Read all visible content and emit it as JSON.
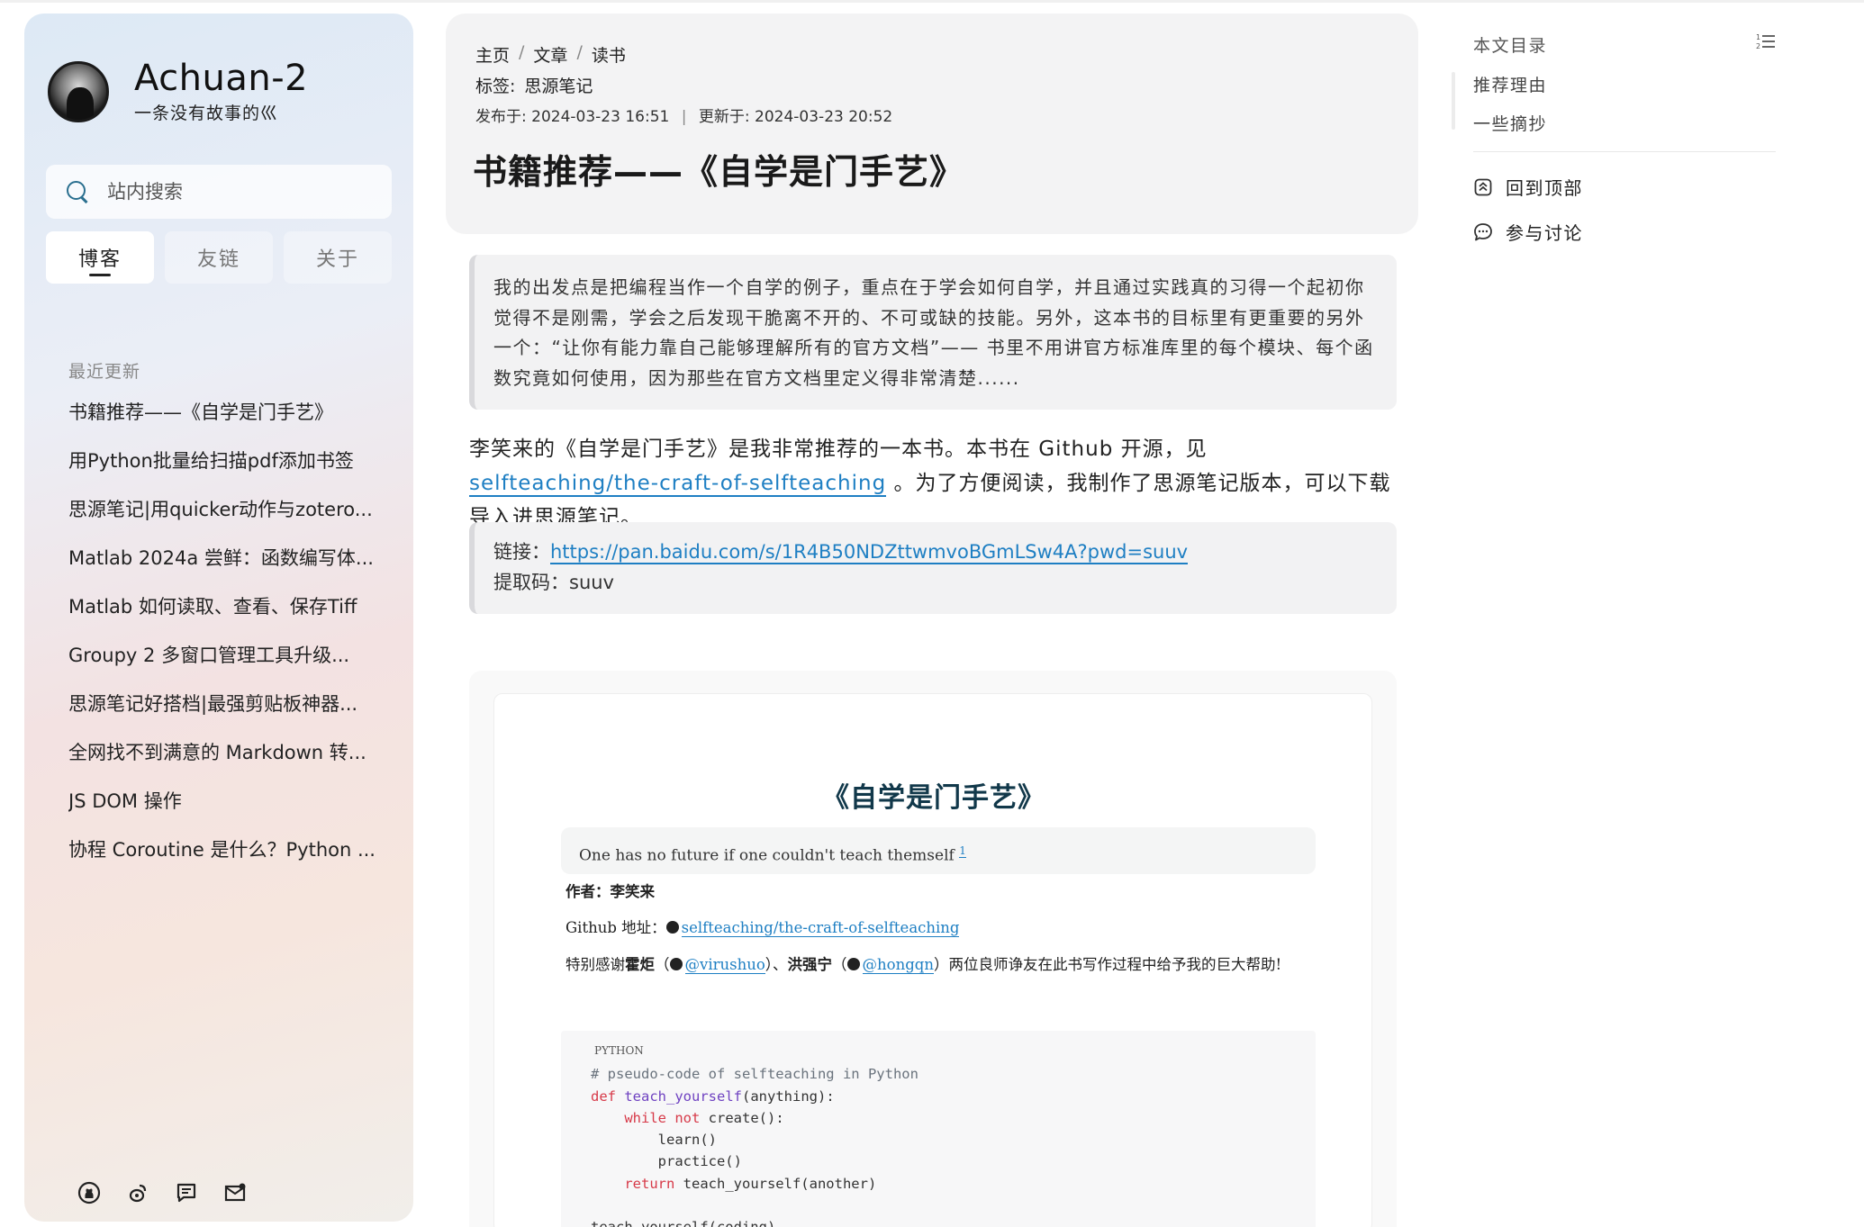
{
  "site": {
    "name": "Achuan-2",
    "subtitle": "一条没有故事的巛"
  },
  "search": {
    "placeholder": "站内搜索"
  },
  "tabs": [
    {
      "label": "博客"
    },
    {
      "label": "友链"
    },
    {
      "label": "关于"
    }
  ],
  "recent": {
    "title": "最近更新",
    "items": [
      "书籍推荐——《自学是门手艺》",
      "用Python批量给扫描pdf添加书签",
      "思源笔记|用quicker动作与zotero...",
      "Matlab 2024a 尝鲜：函数编写体...",
      "Matlab 如何读取、查看、保存Tiff",
      "Groupy 2 多窗口管理工具升级...",
      "思源笔记好搭档|最强剪贴板神器...",
      "全网找不到满意的 Markdown 转...",
      "JS DOM 操作",
      "协程 Coroutine 是什么？Python ..."
    ]
  },
  "social_icons": [
    "github-icon",
    "weibo-icon",
    "comment-icon",
    "mail-icon"
  ],
  "header": {
    "breadcrumb": [
      "主页",
      "文章",
      "读书"
    ],
    "breadcrumb_sep": "/",
    "tags_label": "标签:",
    "tag": "思源笔记",
    "published_label": "发布于:",
    "published": "2024-03-23 16:51",
    "date_sep": "|",
    "updated_label": "更新于:",
    "updated": "2024-03-23 20:52",
    "title": "书籍推荐——《自学是门手艺》"
  },
  "article": {
    "quote": "我的出发点是把编程当作一个自学的例子，重点在于学会如何自学，并且通过实践真的习得一个起初你觉得不是刚需，学会之后发现干脆离不开的、不可或缺的技能。另外，这本书的目标里有更重要的另外一个：“让你有能力靠自己能够理解所有的官方文档”—— 书里不用讲官方标准库里的每个模块、每个函数究竟如何使用，因为那些在官方文档里定义得非常清楚......",
    "para_before": "李笑来的《自学是门手艺》是我非常推荐的一本书。本书在 Github 开源，见 ",
    "para_link": "selfteaching/the-craft-of-selfteaching",
    "para_after": " 。为了方便阅读，我制作了思源笔记版本，可以下载导入进思源笔记。",
    "link_label": "链接：",
    "link_url": "https://pan.baidu.com/s/1R4B50NDZttwmvoBGmLSw4A?pwd=suuv",
    "code_label": "提取码：",
    "code_value": "suuv"
  },
  "embed": {
    "title": "《自学是门手艺》",
    "motto": "One has no future if one couldn't teach themself ",
    "motto_ref": "1",
    "author_label": "作者：",
    "author": "李笑来",
    "github_label": "Github 地址：",
    "github_link": "selfteaching/the-craft-of-selfteaching",
    "thanks_prefix": "特别感谢",
    "thanks_name1": "霍炬",
    "thanks_link1": "@virushuo",
    "thanks_mid": "、",
    "thanks_name2": "洪强宁",
    "thanks_link2": "@hongqn",
    "thanks_suffix": "两位良师诤友在此书写作过程中给予我的巨大帮助!",
    "code_lang": "PYTHON",
    "code_lines": {
      "l1": "# pseudo-code of selfteaching in Python",
      "l2_kw": "def",
      "l2_fn": "teach_yourself",
      "l2_rest": "(anything):",
      "l3_kw": "while not",
      "l3_rest": " create():",
      "l4": "learn()",
      "l5": "practice()",
      "l6_kw": "return",
      "l6_rest": " teach_yourself(another)",
      "l7": "teach_yourself(coding)"
    }
  },
  "toc": {
    "title": "本文目录",
    "items": [
      "推荐理由",
      "一些摘抄"
    ],
    "back_to_top": "回到顶部",
    "discuss": "参与讨论"
  },
  "colors": {
    "link": "#1e7fc3",
    "code_keyword": "#d73a49",
    "code_function": "#6f42c1",
    "embed_title": "#11384a"
  }
}
